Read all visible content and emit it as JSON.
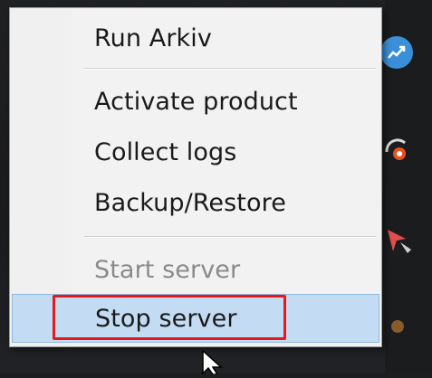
{
  "menu": {
    "items": [
      {
        "label": "Run Arkiv",
        "enabled": true
      },
      {
        "label": "Activate product",
        "enabled": true
      },
      {
        "label": "Collect logs",
        "enabled": true
      },
      {
        "label": "Backup/Restore",
        "enabled": true
      },
      {
        "label": "Start server",
        "enabled": false
      },
      {
        "label": "Stop server",
        "enabled": true,
        "highlighted": true
      }
    ]
  },
  "colors": {
    "highlight": "#c4dcf3",
    "annotation": "#e21a1a",
    "disabled_text": "#8a8a8a"
  },
  "icons": [
    "chart-icon",
    "sync-icon",
    "pin-icon",
    "tray-icon",
    "cursor-icon"
  ]
}
